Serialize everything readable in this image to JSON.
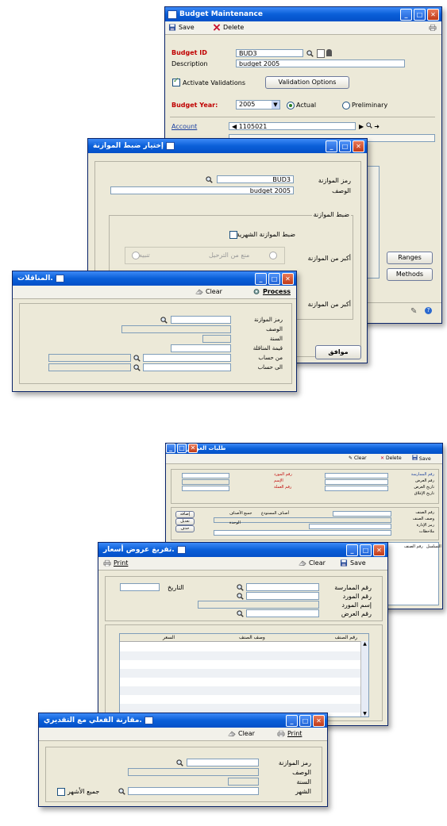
{
  "budget": {
    "title": "Budget Maintenance",
    "save": "Save",
    "delete": "Delete",
    "budget_id_label": "Budget ID",
    "budget_id_value": "BUD3",
    "description_label": "Description",
    "description_value": "budget 2005",
    "activate_validations": "Activate Validations",
    "validation_options": "Validation Options",
    "budget_year_label": "Budget Year:",
    "budget_year_value": "2005",
    "actual": "Actual",
    "preliminary": "Preliminary",
    "account_label": "Account",
    "account_value": "1105021",
    "ranges": "Ranges",
    "methods": "Methods"
  },
  "control": {
    "title": "إختيار ضبط الموازنة",
    "budget_code_label": "رمز الموازنة",
    "budget_code_value": "BUD3",
    "description_label": "الوصف",
    "description_value": "budget 2005",
    "group_label": "ضبط الموازنة",
    "monthly_control": "ضبط الموازنة الشهرية",
    "over_budget": "أكبر من الموازنة",
    "over_budget_2": "أكبر من الموازنة",
    "option_prevent": "منع من الترحيل",
    "option_warn": "تنبيه",
    "ok": "موافق"
  },
  "tenders": {
    "title": "المناقلات.",
    "clear": "Clear",
    "process": "Process",
    "budget_code": "رمز الموازنة",
    "description": "الوصف",
    "year": "السنة",
    "transfer_amount": "قيمة المناقلة",
    "from_account": "من حساب",
    "to_account": "الى حساب"
  },
  "offers_bg": {
    "title": "طلبات العروض",
    "clear": "Clear",
    "delete": "Delete",
    "save": "Save",
    "left_labels": [
      "رقم المورد",
      "الإسم",
      "رقم العملة"
    ],
    "right_labels": [
      "رقم الممارسة",
      "رقم العرض",
      "تاريخ العرض",
      "تاريخ الإغلاق"
    ],
    "item_labels": [
      "رقم الصنف",
      "وصف الصنف",
      "رمز الإدارة",
      "ملاحظات"
    ],
    "chk_all": "جميع الأصناف",
    "chk_cat": "أصناف المستودع",
    "unit": "الوحدة",
    "side_buttons": [
      "إضافة",
      "تعديل",
      "حذف"
    ],
    "grid_headers": [
      "رقم الصنف",
      "التسلسل"
    ]
  },
  "offers": {
    "title": "تفريغ عروض أسعار.",
    "print": "Print",
    "clear": "Clear",
    "save": "Save",
    "date_label": "التاريخ",
    "labels": [
      "رقم الممارسة",
      "رقم المورد",
      "إسم المورد",
      "رقم العرض"
    ],
    "grid_headers": [
      "رقم الصنف",
      "وصف الصنف",
      "السعر"
    ]
  },
  "compare": {
    "title": "مقارنة الفعلي مع التقديري.",
    "clear": "Clear",
    "print": "Print",
    "budget_code": "رمز الموازنة",
    "description": "الوصف",
    "year": "السنة",
    "month": "الشهر",
    "all_months": "جميع الأشهر"
  },
  "colors": {
    "title_bar": "#0a5fd8",
    "window_bg": "#ece9d8",
    "required_label": "#c00000"
  }
}
